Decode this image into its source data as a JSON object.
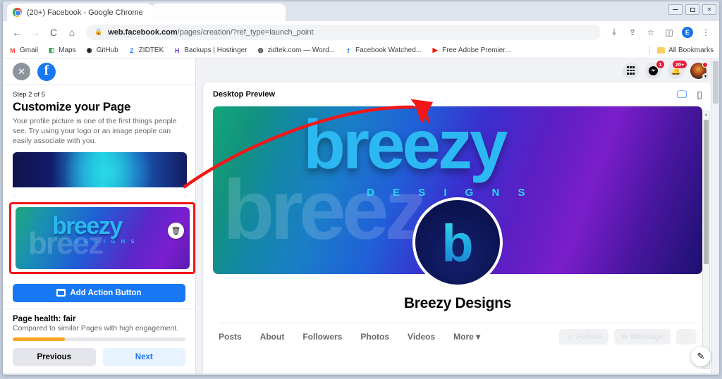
{
  "window": {
    "title": "(20+) Facebook - Google Chrome",
    "controls": {
      "minimize": "–",
      "maximize": "□",
      "close": "✕"
    }
  },
  "browser": {
    "back_icon": "←",
    "forward_icon": "→",
    "reload_icon": "C",
    "home_icon": "⌂",
    "lock_icon": "🔒",
    "url_host": "web.facebook.com",
    "url_path": "/pages/creation/?ref_type=launch_point",
    "right_icons": [
      "install-icon",
      "share-icon",
      "bookmark-star-icon",
      "side-panel-icon"
    ],
    "profile_initial": "E",
    "menu_icon": "⋮",
    "bookmarks": [
      {
        "label": "Gmail",
        "icon": "M",
        "color": "#ea4335"
      },
      {
        "label": "Maps",
        "icon": "◧",
        "color": "#34a853"
      },
      {
        "label": "GitHub",
        "icon": "◉",
        "color": "#171515"
      },
      {
        "label": "ZIDTEK",
        "icon": "Z",
        "color": "#2d7ff9"
      },
      {
        "label": "Backups | Hostinger",
        "icon": "H",
        "color": "#673de6"
      },
      {
        "label": "zidtek.com — Word...",
        "icon": "◍",
        "color": "#3c4043"
      },
      {
        "label": "Facebook Watched...",
        "icon": "f",
        "color": "#1877f2"
      },
      {
        "label": "Free Adobe Premier...",
        "icon": "▶",
        "color": "#ff0000"
      }
    ],
    "all_bookmarks_label": "All Bookmarks"
  },
  "wizard": {
    "close_icon": "✕",
    "brand_icon": "f",
    "step_label": "Step 2 of 5",
    "title": "Customize your Page",
    "description": "Your profile picture is one of the first things people see. Try using your logo or an image people can easily associate with you.",
    "cover_thumb_name": "cover-photo-thumbnail",
    "profile_thumb": {
      "brand": "breezy",
      "sub": "D E S I G N S",
      "ghost": "breez",
      "delete_icon": "🗑"
    },
    "action_button_label": "Add Action Button",
    "health_title": "Page health: fair",
    "health_sub": "Compared to similar Pages with high engagement.",
    "health_percent": 30,
    "previous_label": "Previous",
    "next_label": "Next"
  },
  "fb_topbar": {
    "grid_icon": "grid-menu-icon",
    "messenger_icon": "messenger-icon",
    "messenger_badge": "1",
    "bell_icon": "🔔",
    "bell_badge": "20+",
    "avatar_icon": "user-avatar",
    "avatar_chevron": "▾"
  },
  "preview": {
    "header_title": "Desktop Preview",
    "desktop_icon": "🖵",
    "mobile_icon": "▯",
    "banner": {
      "brand": "breezy",
      "sub": "D E S I G N S",
      "ghost": "breez",
      "avatar_letter": "b"
    },
    "page_name": "Breezy Designs",
    "tabs": [
      "Posts",
      "About",
      "Followers",
      "Photos",
      "Videos"
    ],
    "more_label": "More",
    "more_caret": "▾",
    "actions": [
      {
        "label": "Follow",
        "icon": "＋"
      },
      {
        "label": "Message",
        "icon": "✉"
      }
    ],
    "overflow_label": "···",
    "edit_fab_icon": "✎"
  },
  "colors": {
    "fb_blue": "#1877f2",
    "accent_red": "#f21616",
    "health_orange": "#f5a623",
    "badge_red": "#e41e3f",
    "brand_cyan": "#2cb8f2"
  }
}
